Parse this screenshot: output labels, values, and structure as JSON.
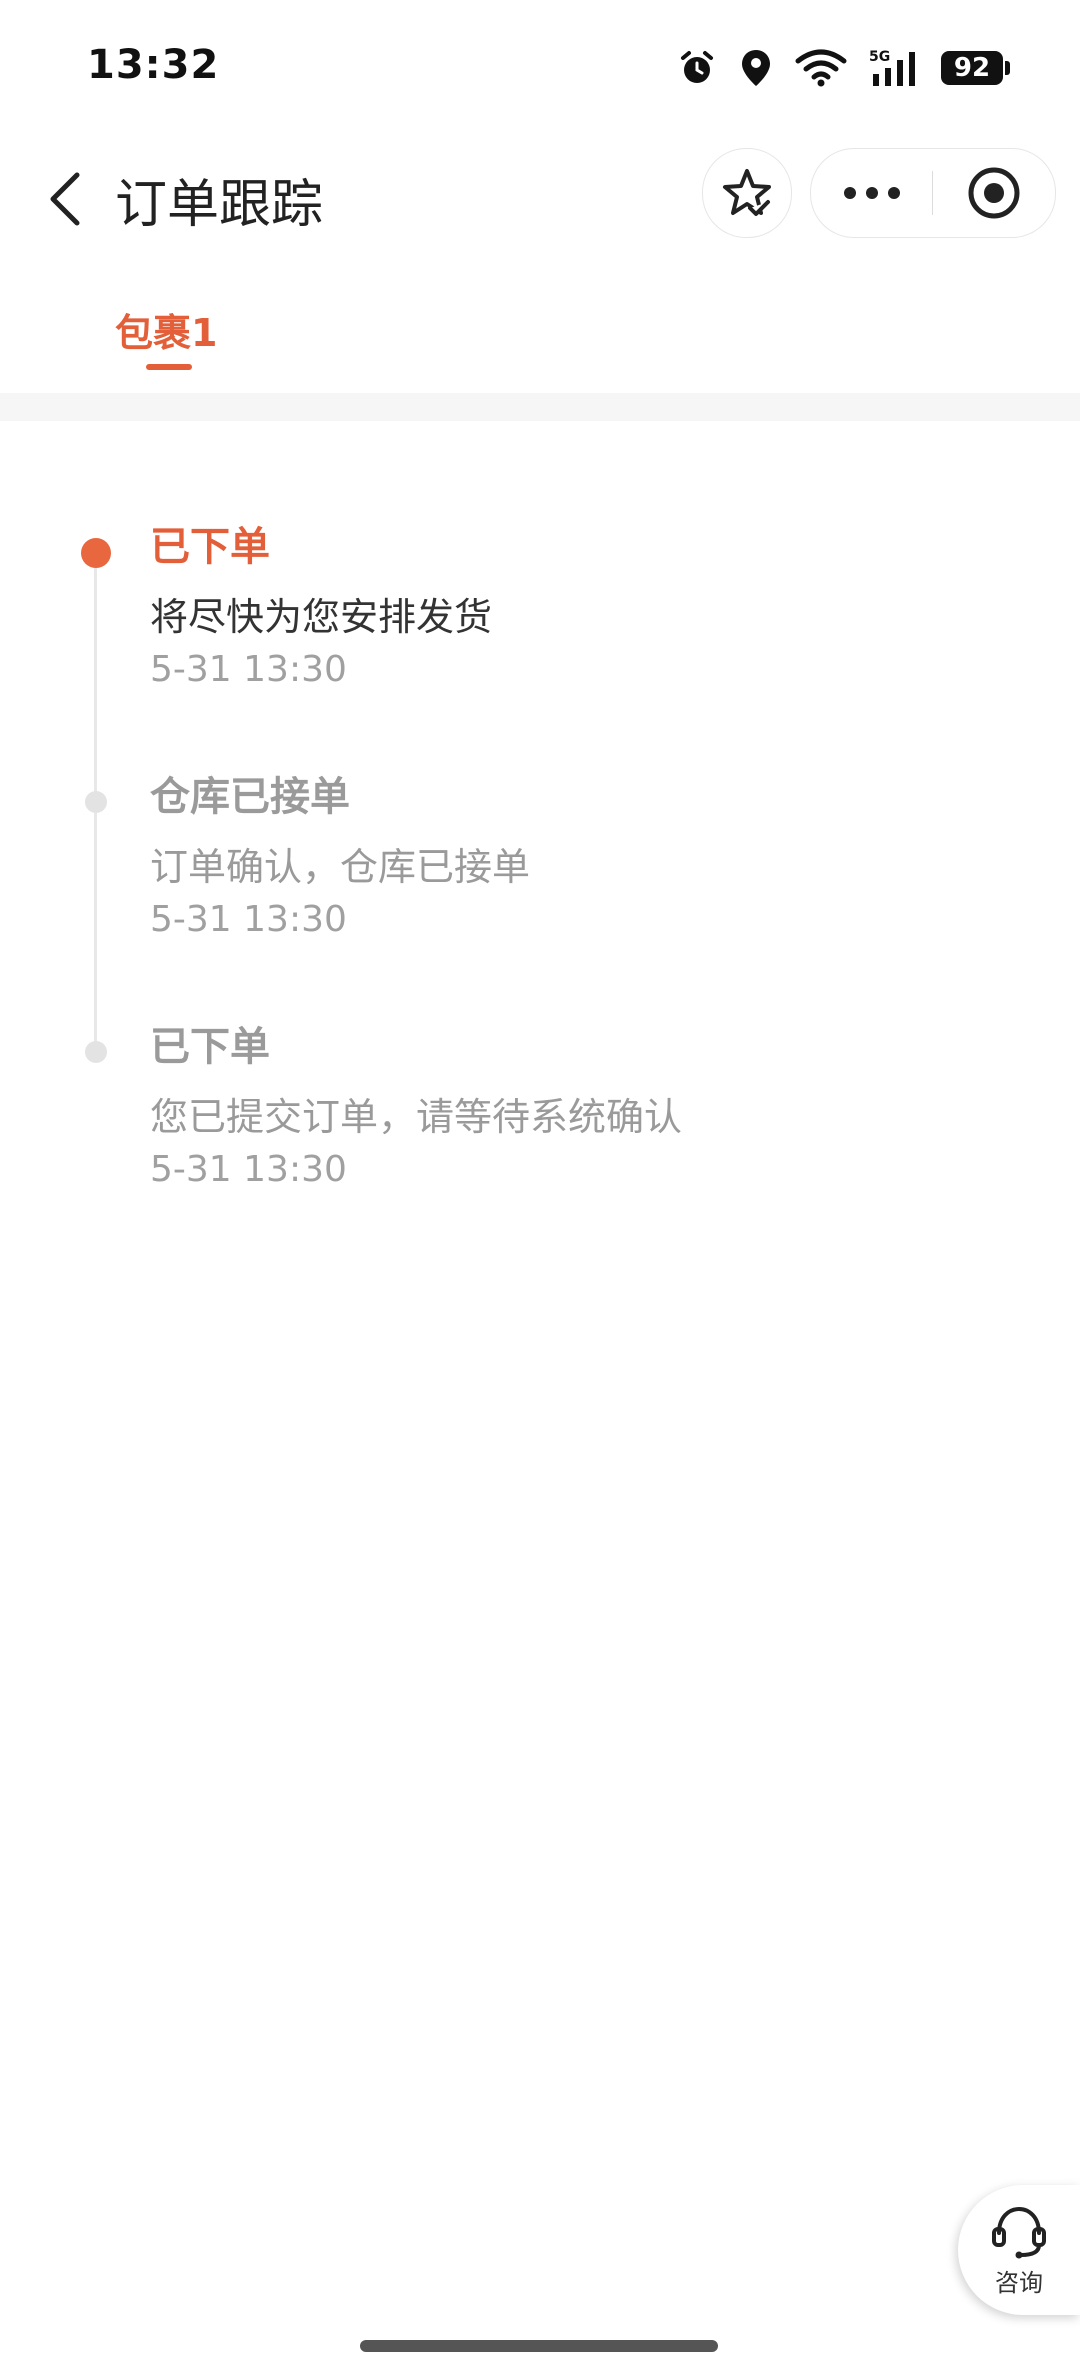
{
  "status_bar": {
    "time": "13:32",
    "network": "5G",
    "battery": "92"
  },
  "nav": {
    "title": "订单跟踪"
  },
  "tabs": [
    {
      "label": "包裹1",
      "active": true
    }
  ],
  "timeline": [
    {
      "status": "已下单",
      "desc": "将尽快为您安排发货",
      "time": "5-31 13:30",
      "active": true
    },
    {
      "status": "仓库已接单",
      "desc": "订单确认，仓库已接单",
      "time": "5-31 13:30",
      "active": false
    },
    {
      "status": "已下单",
      "desc": "您已提交订单，请等待系统确认",
      "time": "5-31 13:30",
      "active": false
    }
  ],
  "consult": {
    "label": "咨询"
  },
  "colors": {
    "accent": "#e35f39",
    "muted": "#9a9a9a"
  }
}
